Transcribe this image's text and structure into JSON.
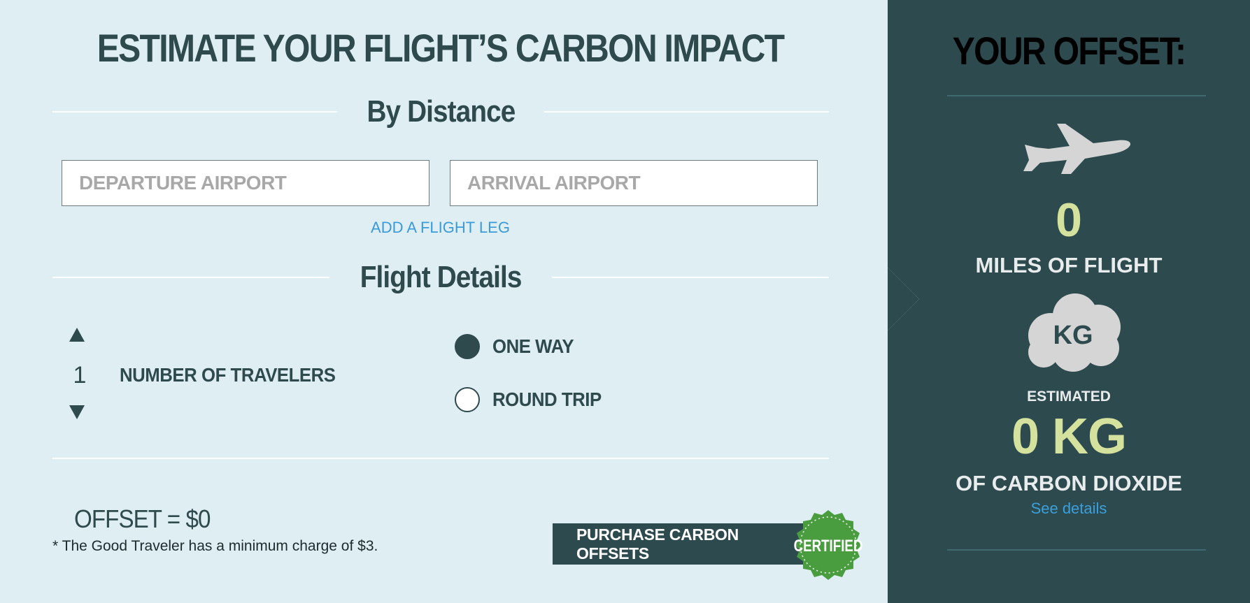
{
  "form": {
    "title": "ESTIMATE YOUR FLIGHT’S CARBON IMPACT",
    "distance_heading": "By Distance",
    "departure_placeholder": "DEPARTURE AIRPORT",
    "arrival_placeholder": "ARRIVAL AIRPORT",
    "add_leg_label": "ADD A FLIGHT LEG",
    "details_heading": "Flight Details",
    "travelers_count": "1",
    "travelers_label": "NUMBER OF TRAVELERS",
    "trip_options": [
      {
        "label": "ONE WAY",
        "selected": true
      },
      {
        "label": "ROUND TRIP",
        "selected": false
      }
    ],
    "offset_text": "OFFSET = $0",
    "minimum_note": "* The Good Traveler has a minimum charge of $3.",
    "purchase_label": "PURCHASE CARBON OFFSETS",
    "seal_text": "CERTIFIED"
  },
  "summary": {
    "title": "YOUR OFFSET:",
    "miles_value": "0",
    "miles_label": "MILES OF FLIGHT",
    "cloud_text": "KG",
    "estimated_label": "ESTIMATED",
    "kg_value": "0 KG",
    "co2_label": "OF CARBON DIOXIDE",
    "details_link": "See details"
  },
  "colors": {
    "panel_bg": "#deeef3",
    "dark_panel": "#2d4a4e",
    "accent_value": "#d4e29d",
    "link": "#3a9bd8",
    "seal_green": "#4a9d3f"
  },
  "icons": {
    "plane": "airplane-icon",
    "cloud": "cloud-kg-icon",
    "stepper_up": "triangle-up-icon",
    "stepper_down": "triangle-down-icon",
    "seal": "certified-seal-icon"
  }
}
